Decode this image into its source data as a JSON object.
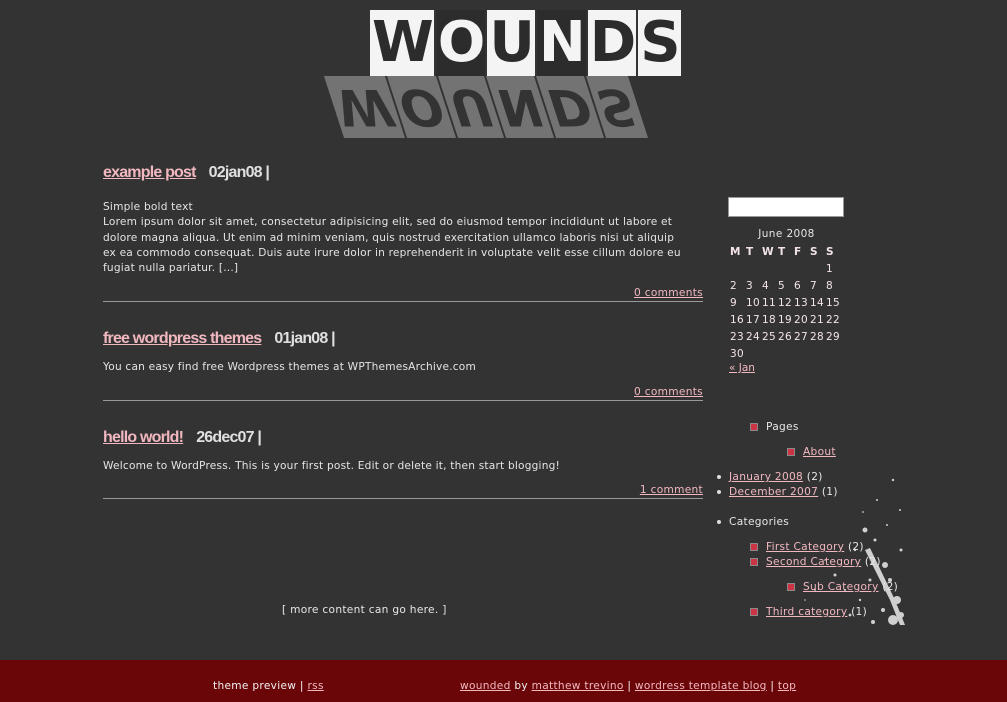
{
  "header": {
    "logo_text": [
      "W",
      "O",
      "U",
      "N",
      "D",
      "S"
    ],
    "logo_alt": "WOUNDS"
  },
  "posts": [
    {
      "title": "example post",
      "date": "02jan08 |",
      "body_lines": [
        "Simple bold text",
        "Lorem ipsum dolor sit amet, consectetur adipisicing elit, sed do eiusmod tempor incididunt ut labore et",
        "dolore magna aliqua. Ut enim ad minim veniam, quis nostrud exercitation ullamco laboris nisi ut aliquip",
        "ex ea commodo consequat. Duis aute irure dolor in reprehenderit in voluptate velit esse cillum dolore eu",
        "fugiat nulla pariatur. [...]"
      ],
      "comments": "0 comments"
    },
    {
      "title": "free wordpress themes",
      "date": "01jan08 |",
      "body_lines": [
        "You can easy find free Wordpress themes at WPThemesArchive.com"
      ],
      "comments": "0 comments"
    },
    {
      "title": "hello world!",
      "date": "26dec07 |",
      "body_lines": [
        "Welcome to WordPress. This is your first post. Edit or delete it, then start blogging!"
      ],
      "comments": "1 comment"
    }
  ],
  "more_content": "[ more content can go here. ]",
  "sidebar": {
    "search": {
      "value": "",
      "placeholder": ""
    },
    "calendar": {
      "caption": "June 2008",
      "weekdays": [
        "M",
        "T",
        "W",
        "T",
        "F",
        "S",
        "S"
      ],
      "weeks": [
        [
          "",
          "",
          "",
          "",
          "",
          "",
          "1"
        ],
        [
          "2",
          "3",
          "4",
          "5",
          "6",
          "7",
          "8"
        ],
        [
          "9",
          "10",
          "11",
          "12",
          "13",
          "14",
          "15"
        ],
        [
          "16",
          "17",
          "18",
          "19",
          "20",
          "21",
          "22"
        ],
        [
          "23",
          "24",
          "25",
          "26",
          "27",
          "28",
          "29"
        ],
        [
          "30",
          "",
          "",
          "",
          "",
          "",
          ""
        ]
      ],
      "prev_link": "« Jan"
    },
    "pages": {
      "heading": "Pages",
      "items": [
        "About"
      ]
    },
    "archives": [
      {
        "label": "January 2008",
        "count": "(2)"
      },
      {
        "label": "December 2007",
        "count": "(1)"
      }
    ],
    "categories": {
      "heading": "Categories",
      "items": [
        {
          "label": "First Category",
          "count": "(2)"
        },
        {
          "label": "Second Category",
          "count": "(2)"
        },
        {
          "label": "Sub Category",
          "count": "(2)"
        },
        {
          "label": "Third category",
          "count": "(1)"
        }
      ]
    }
  },
  "footer": {
    "left_text": "theme preview |",
    "rss": "rss",
    "wounded": "wounded",
    "by": "by",
    "author": "matthew trevino",
    "sep1": "|",
    "blog": "wordress template blog",
    "sep2": "|",
    "top": "top"
  },
  "colors": {
    "background": "#333333",
    "link": "#f2b8c0",
    "footer_bg": "#6b0608",
    "bullet_square": "#cc3344"
  }
}
